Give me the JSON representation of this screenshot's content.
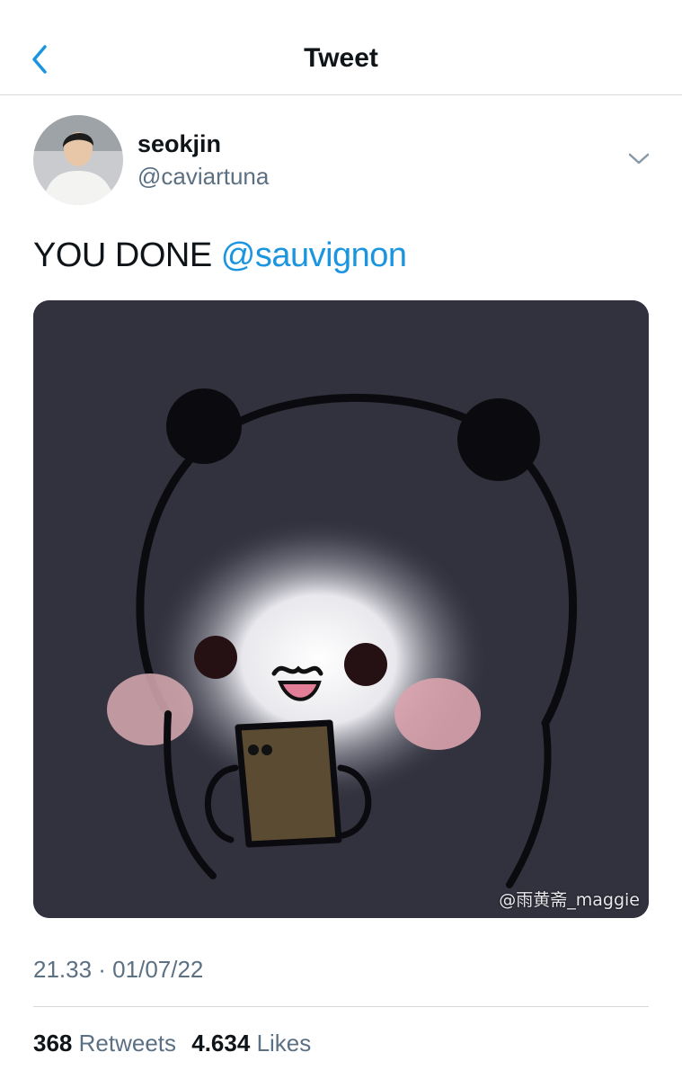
{
  "header": {
    "title": "Tweet",
    "back_icon": "chevron-left-icon"
  },
  "author": {
    "name": "seokjin",
    "handle": "@caviartuna",
    "avatar": "profile-photo"
  },
  "tweet": {
    "text": "YOU DONE ",
    "mention": "@sauvignon"
  },
  "media": {
    "description_icon": "panda-image",
    "watermark": "@雨黄斋_maggie"
  },
  "meta": {
    "timestamp": "21.33 · 01/07/22"
  },
  "stats": {
    "retweets_count": "368",
    "retweets_label": "Retweets",
    "likes_count": "4.634",
    "likes_label": "Likes"
  },
  "colors": {
    "link": "#1b95e0",
    "muted": "#5b7083",
    "image_bg": "#32323e"
  }
}
